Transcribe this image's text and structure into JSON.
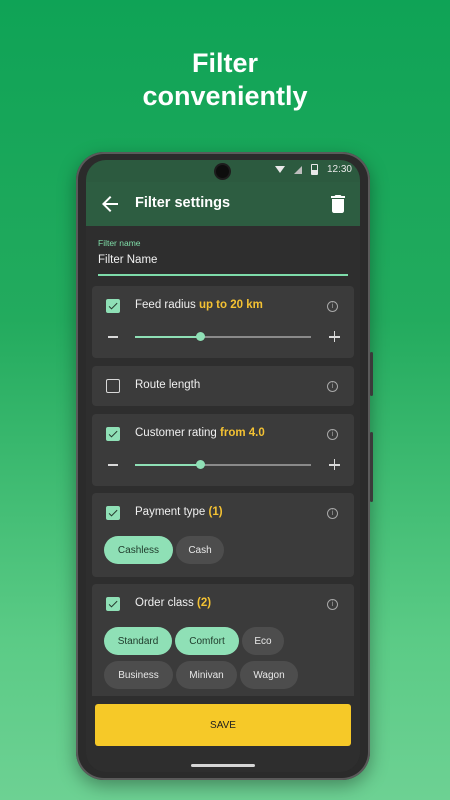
{
  "headline": {
    "line1": "Filter",
    "line2": "conveniently"
  },
  "status_bar": {
    "time": "12:30"
  },
  "app_bar": {
    "title": "Filter settings"
  },
  "filter_name": {
    "label": "Filter name",
    "value": "Filter Name"
  },
  "filters": {
    "feed_radius": {
      "label": "Feed radius",
      "highlight": "up to 20 km",
      "checked": true,
      "slider_value": 0.37
    },
    "route_length": {
      "label": "Route length",
      "checked": false
    },
    "customer_rating": {
      "label": "Customer rating",
      "highlight": "from 4.0",
      "checked": true,
      "slider_value": 0.37
    },
    "payment_type": {
      "label": "Payment type",
      "count": "(1)",
      "checked": true,
      "options": [
        {
          "label": "Cashless",
          "selected": true
        },
        {
          "label": "Cash",
          "selected": false
        }
      ]
    },
    "order_class": {
      "label": "Order class",
      "count": "(2)",
      "checked": true,
      "options": [
        {
          "label": "Standard",
          "selected": true
        },
        {
          "label": "Comfort",
          "selected": true
        },
        {
          "label": "Eco",
          "selected": false
        },
        {
          "label": "Business",
          "selected": false
        },
        {
          "label": "Minivan",
          "selected": false
        },
        {
          "label": "Wagon",
          "selected": false
        }
      ]
    }
  },
  "save_button": {
    "label": "SAVE"
  },
  "icons": {
    "back": "arrow-left-icon",
    "trash": "trash-icon",
    "info": "info-icon",
    "checkbox": "checkbox-icon",
    "minus": "minus-icon",
    "plus": "plus-icon"
  },
  "colors": {
    "background_top": "#0fa356",
    "background_bottom": "#6dd193",
    "app_bar": "#2d5d41",
    "accent": "#8fe0b6",
    "highlight": "#f4c233",
    "save_button": "#f6c928"
  }
}
